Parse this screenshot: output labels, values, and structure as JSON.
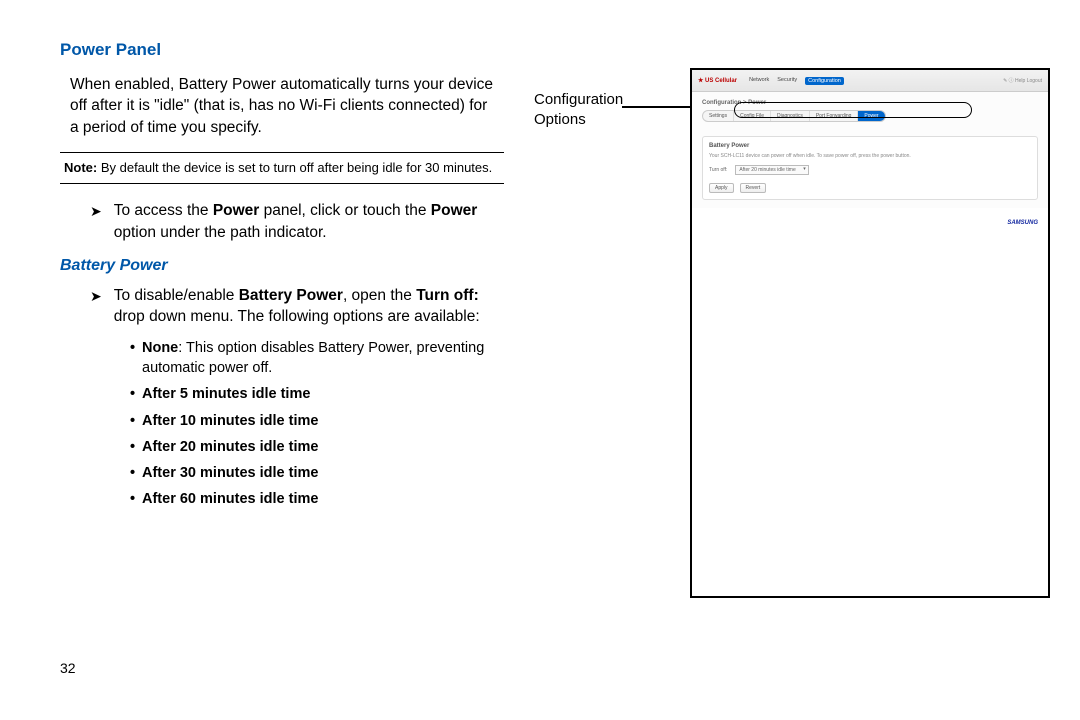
{
  "page_number": "32",
  "heading": "Power Panel",
  "intro": "When enabled, Battery Power automatically turns your device off after it is \"idle\" (that is, has no Wi-Fi clients connected) for a period of time you specify.",
  "note": {
    "label": "Note:",
    "text": " By default the device is set to turn off after being idle for 30 minutes."
  },
  "arrow1_pre": "To access the ",
  "arrow1_b1": "Power",
  "arrow1_mid": " panel, click or touch the ",
  "arrow1_b2": "Power",
  "arrow1_post": " option under the path indicator.",
  "sub_heading": "Battery Power",
  "arrow2_pre": "To disable/enable ",
  "arrow2_b1": "Battery Power",
  "arrow2_mid": ", open the ",
  "arrow2_b2": "Turn off:",
  "arrow2_post": " drop down menu. The following options are available:",
  "none_item": {
    "label": "None",
    "text": ": This option disables Battery Power, preventing automatic power off."
  },
  "idle_options": [
    "After 5 minutes idle time",
    "After 10 minutes idle time",
    "After 20 minutes idle time",
    "After 30 minutes idle time",
    "After 60 minutes idle time"
  ],
  "callout": "Configuration Options",
  "screenshot": {
    "logo": "★ US Cellular",
    "nav": [
      "Network",
      "Security",
      "Configuration"
    ],
    "right": "✎  ⓘ Help  Logout",
    "breadcrumb": "Configuration > Power",
    "tabs": [
      "Settings",
      "Config File",
      "Diagnostics",
      "Port Forwarding",
      "Power"
    ],
    "panel_title": "Battery Power",
    "panel_desc": "Your SCH-LC11 device can power off when idle. To save power off, press the power button.",
    "row_label": "Turn off:",
    "select_value": "After 20 minutes idle time",
    "btn_apply": "Apply",
    "btn_revert": "Revert",
    "brand": "SAMSUNG"
  }
}
